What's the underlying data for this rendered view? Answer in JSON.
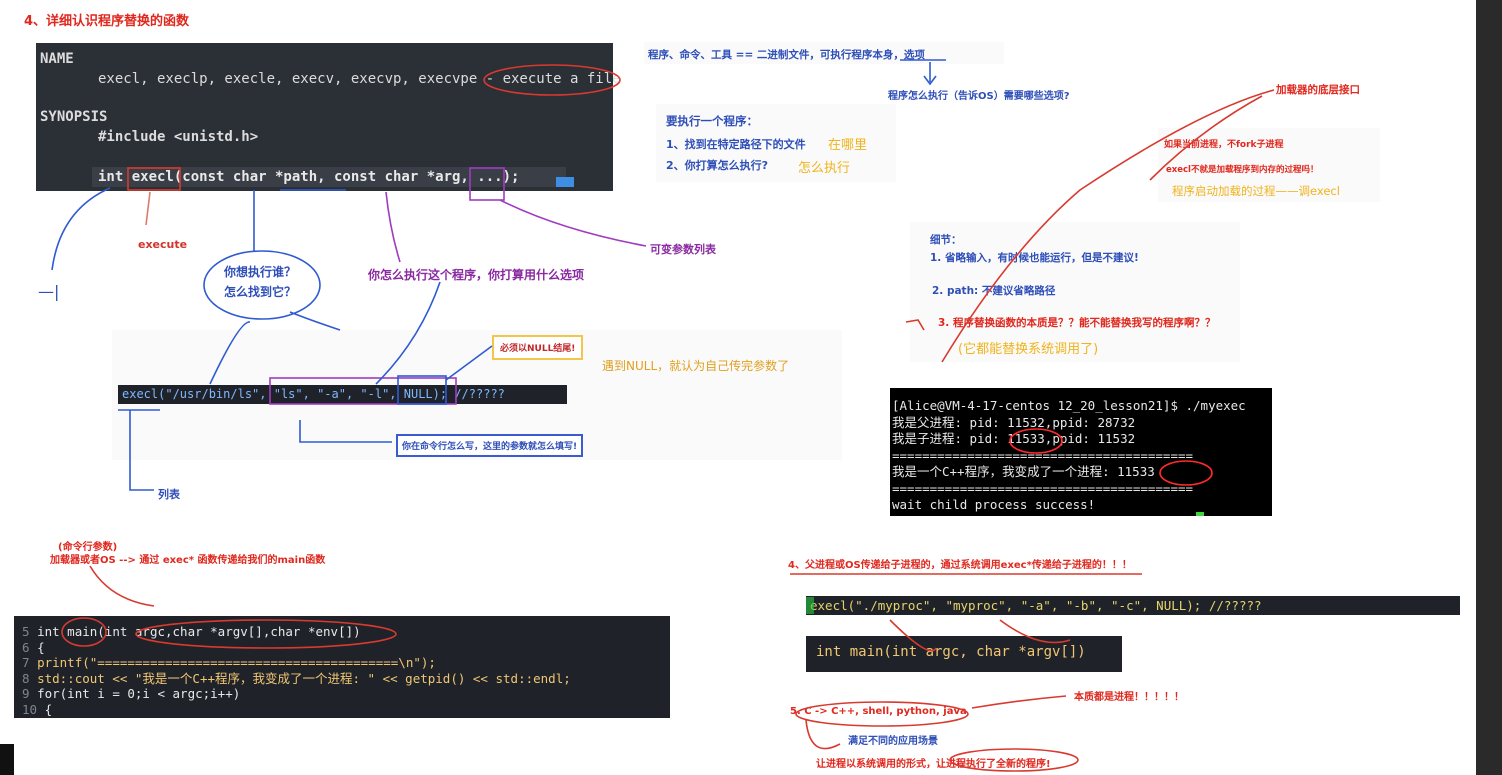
{
  "title": "4、详细认识程序替换的函数",
  "man": {
    "name_header": "NAME",
    "name_line": "execl, execlp, execle, execv, execvp, execvpe - execute a file",
    "synopsis_header": "SYNOPSIS",
    "include_line": "#include <unistd.h>",
    "proto_line": "int execl(const char *path, const char *arg, ...);"
  },
  "notes": {
    "execute": "execute",
    "who": "你想执行谁？",
    "find": "怎么找到它？",
    "how_run": "你怎么执行这个程序，你打算用什么选项",
    "varargs": "可变参数列表",
    "null_end": "必须以NULL结尾!",
    "null_meaning": "遇到NULL，就认为自己传完参数了",
    "cmdline_fill": "你在命令行怎么写，这里的参数就怎么填写!",
    "list": "列表",
    "dash": "—|",
    "cmd_args": "(命令行参数)",
    "loader_pass": "加载器或者OS --> 通过 exec* 函数传递给我们的main函数"
  },
  "right_top": {
    "line1": "程序、命令、工具 == 二进制文件，可执行程序本身，选项",
    "line2": "程序怎么执行（告诉OS）需要哪些选项?",
    "exec_title": "要执行一个程序：",
    "step1": "1、找到在特定路径下的文件",
    "step1_hand": "在哪里",
    "step2": "2、你打算怎么执行?",
    "step2_hand": "怎么执行",
    "loader_iface": "加载器的底层接口",
    "no_fork": "如果当前进程，不fork子进程",
    "execl_load": "execl不就是加载程序到内存的过程吗！",
    "startup": "程序启动加载的过程——调execl"
  },
  "details": {
    "header": "细节：",
    "d1": "1. 省略输入，有时候也能运行，但是不建议!",
    "d2": "2. path: 不建议省略路径",
    "d3": "3. 程序替换函数的本质是？？能不能替换我写的程序啊？？",
    "d3_hand": "(它都能替换系统调用了)"
  },
  "exec_call": {
    "code": "execl(\"/usr/bin/ls\", \"ls\", \"-a\", \"-l\", NULL); //?????"
  },
  "term": {
    "lines": [
      "[Alice@VM-4-17-centos 12_20_lesson21]$ ./myexec",
      "我是父进程: pid: 11532,ppid: 28732",
      "我是子进程: pid: 11533,ppid: 11532",
      "========================================",
      "我是一个C++程序，我变成了一个进程: 11533",
      "========================================",
      "wait child process success!"
    ]
  },
  "code": {
    "lines": [
      {
        "n": "5",
        "t": "int main(int argc,char *argv[],char *env[])"
      },
      {
        "n": "6",
        "t": "{"
      },
      {
        "n": "7",
        "t": "    printf(\"========================================\\n\");"
      },
      {
        "n": "8",
        "t": "    std::cout << \"我是一个C++程序，我变成了一个进程: \" << getpid() << std::endl;"
      },
      {
        "n": "9",
        "t": "    for(int i = 0;i < argc;i++)"
      },
      {
        "n": "10",
        "t": "    {"
      }
    ]
  },
  "bottom_right": {
    "pass_child": "4、父进程或OS传递给子进程的，通过系统调用exec*传递给子进程的！！！",
    "myproc_call": "execl(\"./myproc\", \"myproc\", \"-a\", \"-b\", \"-c\", NULL); //?????",
    "main_sig": "int main(int argc, char *argv[])",
    "langs": "5. C -> C++, shell, python, java",
    "essence": "本质都是进程！！！！！",
    "scenes": "满足不同的应用场景",
    "syscall_form": "让进程以系统调用的形式，让进程执行了全新的程序!"
  }
}
